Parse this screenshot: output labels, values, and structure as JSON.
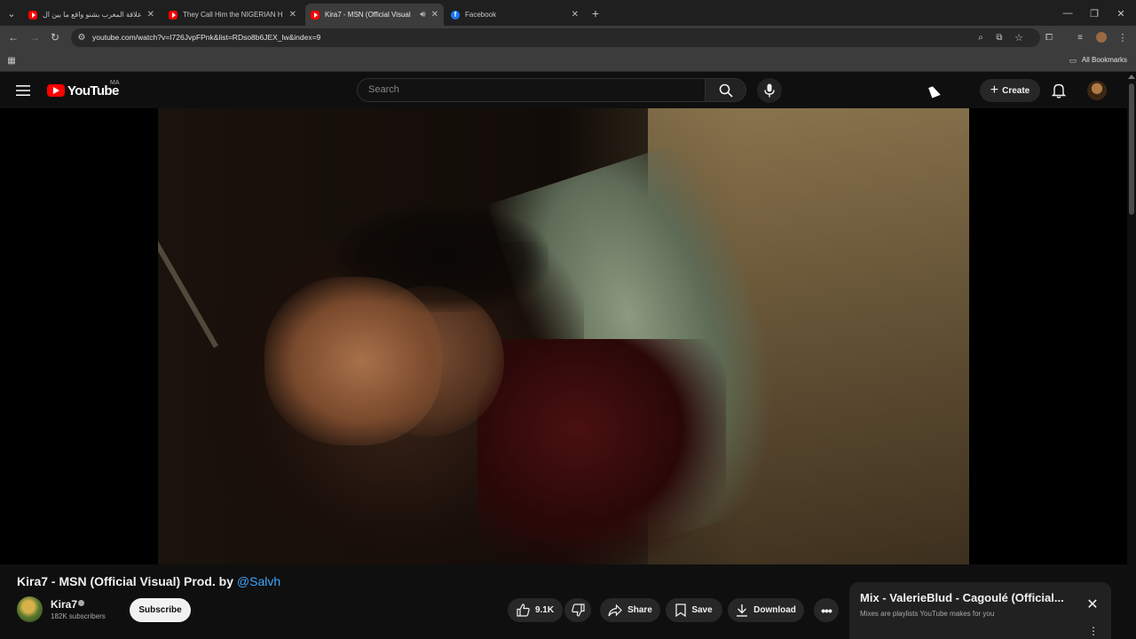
{
  "browser": {
    "tabs": [
      {
        "label": "علاقة المغرب بشنو واقع ما بين ال",
        "icon": "youtube-icon",
        "active": false
      },
      {
        "label": "They Call Him the NIGERIAN H",
        "icon": "youtube-icon",
        "active": false
      },
      {
        "label": "Kira7 - MSN (Official Visual",
        "icon": "youtube-icon",
        "active": true
      },
      {
        "label": "Facebook",
        "icon": "facebook-icon",
        "active": false
      }
    ],
    "url": "youtube.com/watch?v=I726JvpFPnk&list=RDso8b6JEX_lw&index=9",
    "bookmarks_label": "All Bookmarks"
  },
  "youtube": {
    "logo_text": "YouTube",
    "country": "MA",
    "search_placeholder": "Search",
    "create_label": "Create"
  },
  "video": {
    "title": "Kira7 - MSN (Official Visual) Prod. by",
    "title_mention": "@Salvh",
    "channel_name": "Kira7",
    "subscribers": "182K subscribers",
    "subscribe_label": "Subscribe",
    "likes": "9.1K",
    "share_label": "Share",
    "save_label": "Save",
    "download_label": "Download"
  },
  "mix": {
    "title": "Mix - ValerieBlud - Cagoulé (Official...",
    "subtitle": "Mixes are playlists YouTube makes for you"
  },
  "colors": {
    "background": "#0f0f0f",
    "brand_red": "#ff0000",
    "link_blue": "#3ea6ff"
  }
}
